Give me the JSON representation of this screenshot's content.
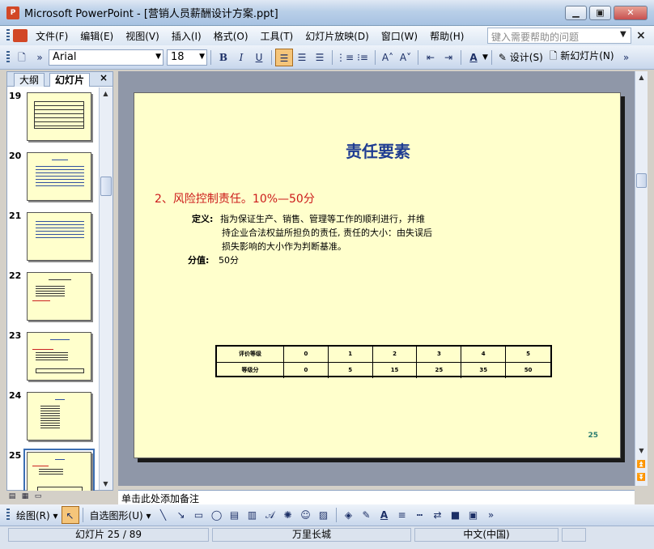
{
  "window": {
    "title": "Microsoft PowerPoint - [营销人员薪酬设计方案.ppt]",
    "logo": "P",
    "minimize": "▁",
    "maximize": "▣",
    "close": "✕"
  },
  "menu": {
    "items": [
      "文件(F)",
      "编辑(E)",
      "视图(V)",
      "插入(I)",
      "格式(O)",
      "工具(T)",
      "幻灯片放映(D)",
      "窗口(W)",
      "帮助(H)"
    ],
    "help_placeholder": "键入需要帮助的问题",
    "close": "×"
  },
  "toolbar": {
    "font": "Arial",
    "size": "18",
    "bold": "B",
    "italic": "I",
    "underline": "U",
    "design": "设计(S)",
    "new_slide": "新幻灯片(N)",
    "font_color": "A"
  },
  "panel": {
    "tab_outline": "大纲",
    "tab_slides": "幻灯片",
    "close": "×",
    "thumb_numbers": [
      "19",
      "20",
      "21",
      "22",
      "23",
      "24",
      "25"
    ],
    "selected": "25"
  },
  "slide": {
    "title": "责任要素",
    "heading": "2、风险控制责任。10%—50分",
    "def_label": "定义:",
    "def_lines": [
      "指为保证生产、销售、管理等工作的顺利进行，并维",
      "持企业合法权益所担负的责任, 责任的大小：由失误后",
      "损失影响的大小作为判断基准。"
    ],
    "value_label": "分值:",
    "value_text": "50分",
    "table": {
      "rows": [
        [
          "评价等级",
          "0",
          "1",
          "2",
          "3",
          "4",
          "5"
        ],
        [
          "等级分",
          "0",
          "5",
          "15",
          "25",
          "35",
          "50"
        ]
      ]
    },
    "page_number": "25"
  },
  "notes": {
    "placeholder": "单击此处添加备注"
  },
  "drawbar": {
    "draw": "绘图(R)",
    "autoshape": "自选图形(U)"
  },
  "status": {
    "slide": "幻灯片 25 / 89",
    "design": "万里长城",
    "lang": "中文(中国)"
  }
}
